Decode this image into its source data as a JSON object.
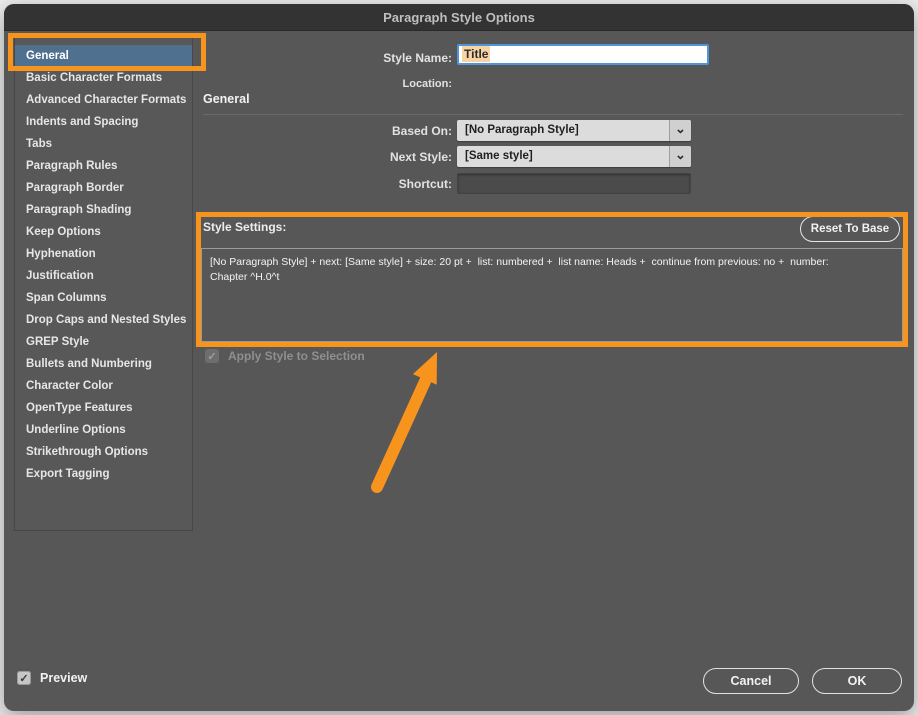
{
  "window": {
    "title": "Paragraph Style Options"
  },
  "sidebar": {
    "selected_item": "General",
    "items": [
      "General",
      "Basic Character Formats",
      "Advanced Character Formats",
      "Indents and Spacing",
      "Tabs",
      "Paragraph Rules",
      "Paragraph Border",
      "Paragraph Shading",
      "Keep Options",
      "Hyphenation",
      "Justification",
      "Span Columns",
      "Drop Caps and Nested Styles",
      "GREP Style",
      "Bullets and Numbering",
      "Character Color",
      "OpenType Features",
      "Underline Options",
      "Strikethrough Options",
      "Export Tagging"
    ]
  },
  "header": {
    "style_name_label": "Style Name:",
    "style_name_value": "Title",
    "location_label": "Location:",
    "location_value": ""
  },
  "general_section": {
    "heading": "General",
    "based_on_label": "Based On:",
    "based_on_value": "[No Paragraph Style]",
    "next_style_label": "Next Style:",
    "next_style_value": "[Same style]",
    "shortcut_label": "Shortcut:",
    "shortcut_value": ""
  },
  "style_settings": {
    "label": "Style Settings:",
    "reset_button_label": "Reset To Base",
    "summary_line1": "[No Paragraph Style] + next: [Same style] + size: 20 pt +  list: numbered +  list name: Heads +  continue from previous: no +  number:",
    "summary_line2": "Chapter ^H.0^t"
  },
  "apply_style": {
    "label": "Apply Style to Selection",
    "checked": true,
    "disabled": true
  },
  "footer": {
    "preview_label": "Preview",
    "preview_checked": true,
    "cancel_label": "Cancel",
    "ok_label": "OK"
  },
  "icons": {
    "chevron_down": "⌄",
    "check": "✓"
  },
  "annotations": {
    "accent_color": "#F7941E",
    "boxes": [
      "general-sidebar-item",
      "style-settings-section"
    ],
    "arrow_points_to": "style-settings-section"
  },
  "colors": {
    "accent": "#F7941E",
    "sidebar_selected": "#50708F",
    "name_highlight": "#F8D4A4",
    "focus_border": "#4E95D9"
  }
}
